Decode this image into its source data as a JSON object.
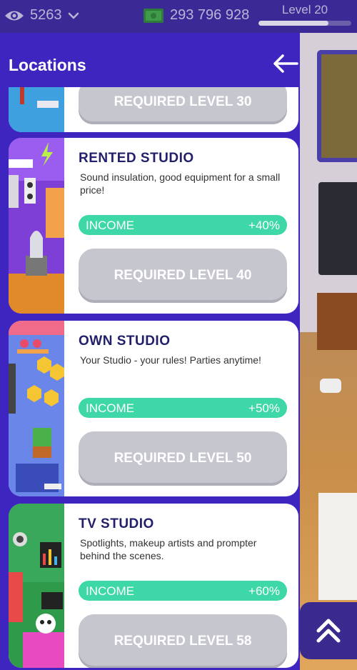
{
  "topbar": {
    "views": "5263",
    "money": "293 796 928",
    "level_label": "Level 20",
    "level_progress": 0.75
  },
  "panel": {
    "title": "Locations"
  },
  "locations": [
    {
      "required": "REQUIRED LEVEL 30"
    },
    {
      "name": "RENTED STUDIO",
      "description": "Sound insulation, good equipment for a small price!",
      "income_label": "INCOME",
      "income_value": "+40%",
      "required": "REQUIRED LEVEL 40"
    },
    {
      "name": "OWN STUDIO",
      "description": "Your Studio - your rules! Parties anytime!",
      "income_label": "INCOME",
      "income_value": "+50%",
      "required": "REQUIRED LEVEL 50"
    },
    {
      "name": "TV STUDIO",
      "description": "Spotlights, makeup artists and prompter behind the scenes.",
      "income_label": "INCOME",
      "income_value": "+60%",
      "required": "REQUIRED LEVEL 58"
    }
  ],
  "colors": {
    "panel": "#3f25c0",
    "income": "#3ed7a8",
    "locked_button": "#c6c6cf",
    "title": "#22206a"
  }
}
